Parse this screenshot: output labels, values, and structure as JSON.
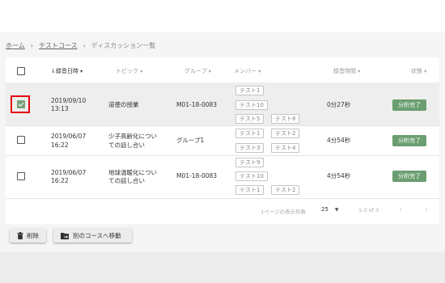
{
  "breadcrumb": {
    "home": "ホーム",
    "course": "テストコース",
    "current": "ディスカッション一覧"
  },
  "table": {
    "headers": {
      "date": "録音日時",
      "topic": "トピック",
      "group": "グループ",
      "members": "メンバー",
      "duration": "録音時間",
      "status": "状態"
    },
    "rows": [
      {
        "checked": true,
        "date": "2019/09/10",
        "time": "13:13",
        "topic_line1": "道徳の授業",
        "topic_line2": "",
        "group": "M01-18-0083",
        "members": [
          "テスト1",
          "テスト10",
          "テスト5",
          "テスト8"
        ],
        "duration": "0分27秒",
        "status": "分析完了"
      },
      {
        "checked": false,
        "date": "2019/06/07",
        "time": "16:22",
        "topic_line1": "少子高齢化につい",
        "topic_line2": "ての話し合い",
        "group": "グループ1",
        "members": [
          "テスト1",
          "テスト2",
          "テスト3",
          "テスト4"
        ],
        "duration": "4分54秒",
        "status": "分析完了"
      },
      {
        "checked": false,
        "date": "2019/06/07",
        "time": "16:22",
        "topic_line1": "地球温暖化につい",
        "topic_line2": "ての話し合い",
        "group": "M01-18-0083",
        "members": [
          "テスト9",
          "テスト10",
          "テスト1",
          "テスト2"
        ],
        "duration": "4分54秒",
        "status": "分析完了"
      }
    ]
  },
  "pagination": {
    "rows_per_page_label": "1ページの表示件数",
    "rows_per_page_value": "25",
    "range": "1-3 of 3"
  },
  "actions": {
    "delete": "削除",
    "move": "別のコースへ移動"
  },
  "colors": {
    "status_badge": "#6b9e70",
    "highlight": "#e60012"
  }
}
